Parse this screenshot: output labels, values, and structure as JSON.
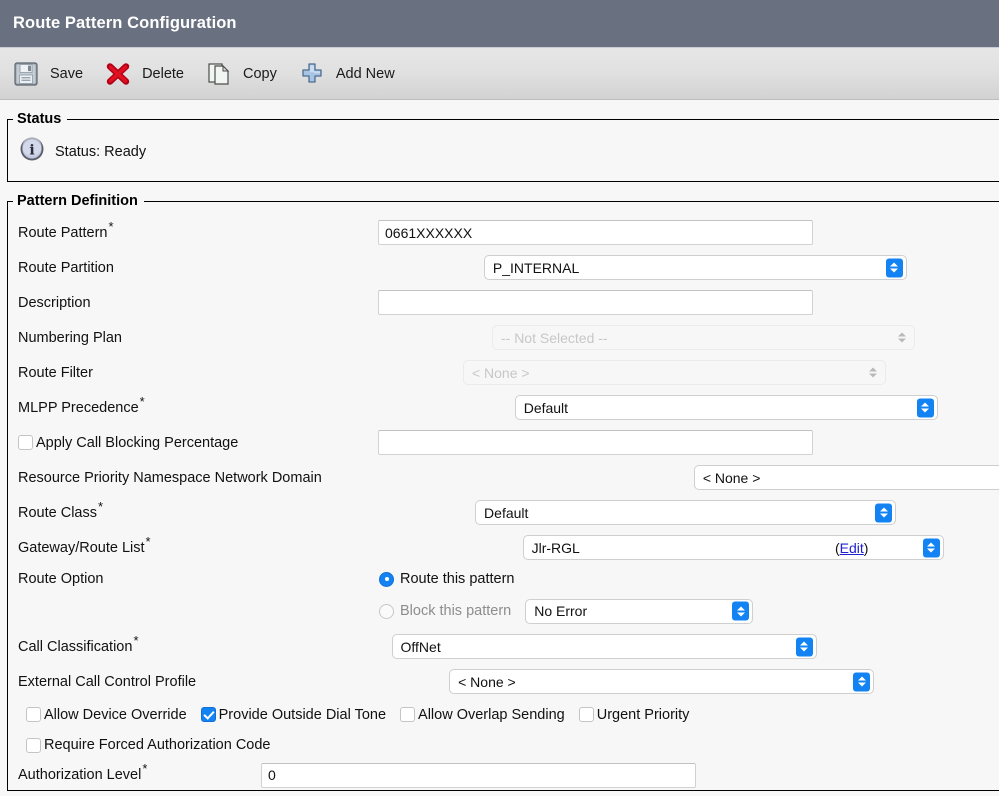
{
  "window": {
    "title": "Route Pattern Configuration"
  },
  "colors": {
    "title_bar": "#69707f",
    "accent_blue": "#1383f4",
    "link": "#2020d0",
    "body_bg": "#f7f7f7",
    "toolbar_bg": "#e1e1e1"
  },
  "toolbar": {
    "items": [
      {
        "label": "Save",
        "icon": "save-floppy-icon"
      },
      {
        "label": "Delete",
        "icon": "delete-x-icon"
      },
      {
        "label": "Copy",
        "icon": "copy-pages-icon"
      },
      {
        "label": "Add New",
        "icon": "add-plus-icon"
      }
    ]
  },
  "status_section": {
    "legend": "Status",
    "icon": "info-icon",
    "text": "Status: Ready"
  },
  "pattern_section": {
    "legend": "Pattern Definition",
    "fields": {
      "route_pattern": {
        "label": "Route Pattern",
        "required": true,
        "value": "0661XXXXXX"
      },
      "route_partition": {
        "label": "Route Partition",
        "required": false,
        "value": "P_INTERNAL",
        "disabled": false
      },
      "description": {
        "label": "Description",
        "required": false,
        "value": ""
      },
      "numbering_plan": {
        "label": "Numbering Plan",
        "required": false,
        "value": "-- Not Selected --",
        "disabled": true
      },
      "route_filter": {
        "label": "Route Filter",
        "required": false,
        "value": "< None >",
        "disabled": true
      },
      "mlpp_precedence": {
        "label": "MLPP Precedence",
        "required": true,
        "value": "Default",
        "disabled": false
      },
      "apply_call_blocking": {
        "label": "Apply Call Blocking Percentage",
        "checked": false,
        "value": ""
      },
      "resource_priority_domain": {
        "label": "Resource Priority Namespace Network Domain",
        "required": false,
        "value": "< None >",
        "disabled": false
      },
      "route_class": {
        "label": "Route Class",
        "required": true,
        "value": "Default",
        "disabled": false
      },
      "gateway_route_list": {
        "label": "Gateway/Route List",
        "required": true,
        "value": "Jlr-RGL",
        "disabled": false,
        "edit_prefix": "(",
        "edit_label": "Edit",
        "edit_suffix": ")"
      },
      "route_option": {
        "label": "Route Option",
        "selected": "route",
        "route_label": "Route this pattern",
        "block_label": "Block this pattern",
        "block_reason_value": "No Error"
      },
      "call_classification": {
        "label": "Call Classification",
        "required": true,
        "value": "OffNet",
        "disabled": false
      },
      "external_call_control_profile": {
        "label": "External Call Control Profile",
        "required": false,
        "value": "< None >",
        "disabled": false
      },
      "authorization_level": {
        "label": "Authorization Level",
        "required": true,
        "value": "0"
      }
    },
    "checkbox_row": [
      {
        "label": "Allow Device Override",
        "checked": false
      },
      {
        "label": "Provide Outside Dial Tone",
        "checked": true
      },
      {
        "label": "Allow Overlap Sending",
        "checked": false
      },
      {
        "label": "Urgent Priority",
        "checked": false
      }
    ],
    "require_forced_auth": {
      "label": "Require Forced Authorization Code",
      "checked": false
    }
  }
}
